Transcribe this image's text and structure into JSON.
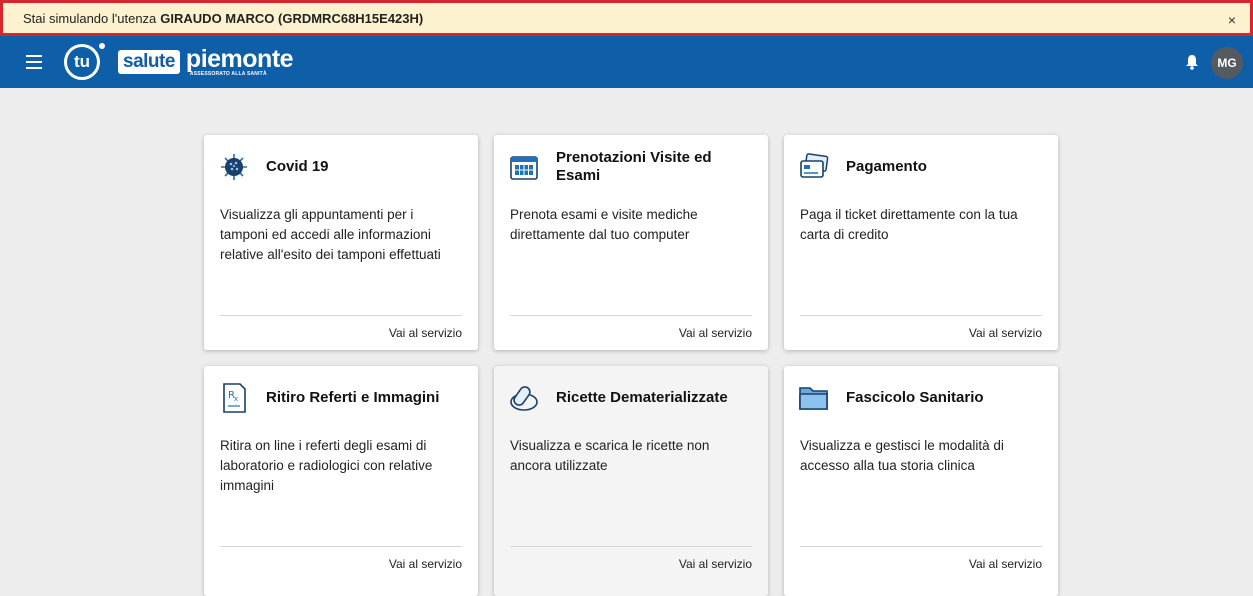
{
  "banner": {
    "prefix": "Stai simulando l'utenza",
    "user": "GIRAUDO MARCO (GRDMRC68H15E423H)",
    "close": "×"
  },
  "header": {
    "logo_tu": "tu",
    "logo_salute": "salute",
    "logo_name": "piemonte",
    "logo_sub": "ASSESSORATO ALLA SANITÀ",
    "avatar_initials": "MG",
    "bar_color": "#0f5ea8"
  },
  "cards": [
    {
      "title": "Covid 19",
      "icon": "virus-icon",
      "desc": "Visualizza gli appuntamenti per i tamponi ed accedi alle informazioni relative all'esito dei tamponi effettuati",
      "link": "Vai al servizio"
    },
    {
      "title": "Prenotazioni Visite ed Esami",
      "icon": "calendar-icon",
      "desc": "Prenota esami e visite mediche direttamente dal tuo computer",
      "link": "Vai al servizio"
    },
    {
      "title": "Pagamento",
      "icon": "credit-card-icon",
      "desc": "Paga il ticket direttamente con la tua carta di credito",
      "link": "Vai al servizio"
    },
    {
      "title": "Ritiro Referti e Immagini",
      "icon": "prescription-document-icon",
      "desc": "Ritira on line i referti degli esami di laboratorio e radiologici con relative immagini",
      "link": "Vai al servizio"
    },
    {
      "title": "Ricette Dematerializzate",
      "icon": "pill-icon",
      "desc": "Visualizza e scarica le ricette non ancora utilizzate",
      "link": "Vai al servizio"
    },
    {
      "title": "Fascicolo Sanitario",
      "icon": "folder-icon",
      "desc": "Visualizza e gestisci le modalità di accesso alla tua storia clinica",
      "link": "Vai al servizio"
    }
  ]
}
